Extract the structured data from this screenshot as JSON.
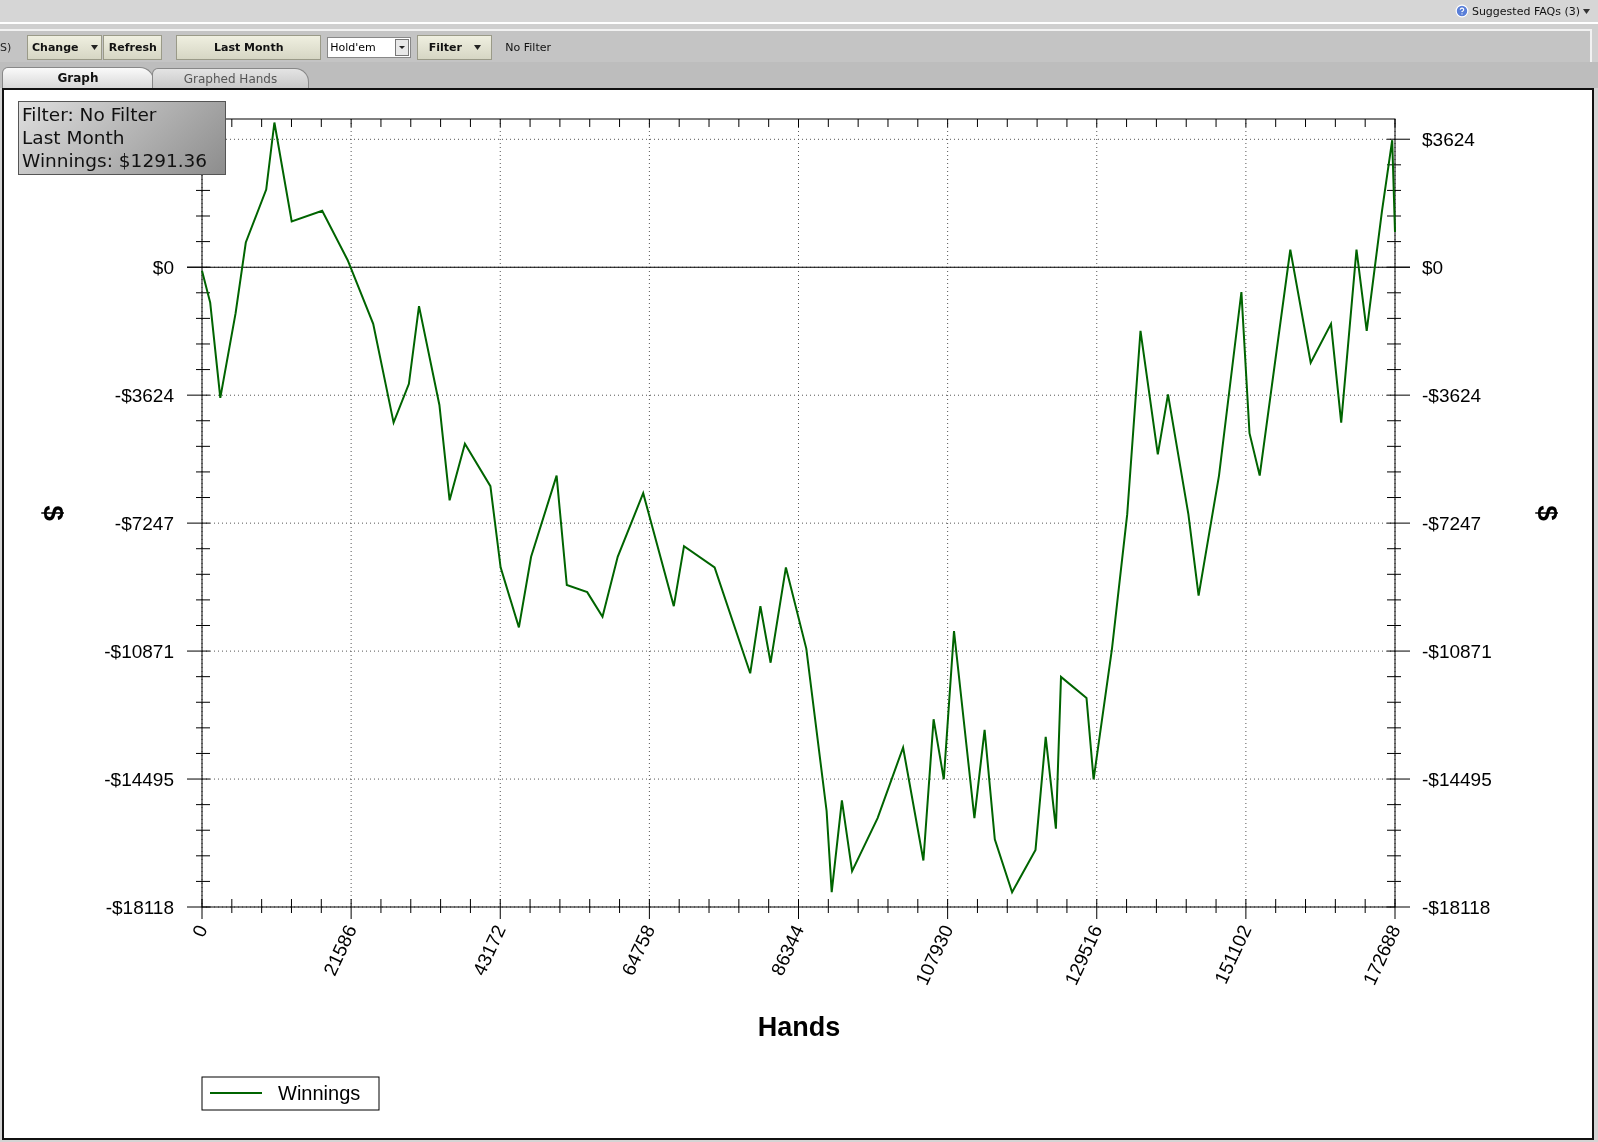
{
  "top_bar": {
    "faq_link": "Suggested FAQs (3)"
  },
  "toolbar": {
    "cut_label": "S)",
    "buttons": [
      {
        "label": "Change",
        "kind": "dropdown"
      },
      {
        "label": "Refresh",
        "kind": "button"
      },
      {
        "label": "Last Month",
        "kind": "wide"
      },
      {
        "label": "Hold'em",
        "kind": "select"
      },
      {
        "label": "Filter",
        "kind": "dropdown"
      }
    ],
    "filter_status": "No Filter"
  },
  "tabs": [
    {
      "label": "Graph",
      "selected": true
    },
    {
      "label": "Graphed Hands",
      "selected": false
    }
  ],
  "info_box": {
    "lines": [
      "Filter: No Filter",
      "Last Month",
      "Winnings: $1291.36"
    ]
  },
  "chart_data": {
    "type": "line",
    "xlabel": "Hands",
    "ylabel": "$",
    "x": [
      0,
      1180,
      2655,
      4868,
      6343,
      9293,
      10473,
      12980,
      17405,
      21093,
      24780,
      27730,
      29943,
      31418,
      34368,
      35843,
      38055,
      41743,
      43218,
      45873,
      47643,
      51330,
      52805,
      55755,
      57968,
      60180,
      63868,
      68293,
      69768,
      74193,
      79355,
      80830,
      82305,
      84518,
      87468,
      90418,
      91155,
      92630,
      94105,
      97793,
      101480,
      104430,
      105905,
      107380,
      108855,
      111805,
      113280,
      114755,
      117263,
      120655,
      122130,
      123605,
      124343,
      128030,
      129063,
      131718,
      133930,
      135848,
      138355,
      139830,
      142780,
      144255,
      147205,
      150450,
      151630,
      153105,
      157530,
      160480,
      163430,
      164905,
      167118,
      168593,
      170805,
      172280,
      172688
    ],
    "series": [
      {
        "name": "Winnings",
        "color": "#006400",
        "values": [
          -100,
          -1000,
          -3700,
          -1300,
          700,
          2200,
          4100,
          1300,
          1600,
          200,
          -1600,
          -4400,
          -3300,
          -1100,
          -3900,
          -6600,
          -5000,
          -6200,
          -8500,
          -10200,
          -8200,
          -5900,
          -9000,
          -9200,
          -9900,
          -8200,
          -6400,
          -9600,
          -7900,
          -8500,
          -11500,
          -9600,
          -11200,
          -8500,
          -10800,
          -15400,
          -17700,
          -15100,
          -17100,
          -15600,
          -13600,
          -16800,
          -12800,
          -14500,
          -10300,
          -15600,
          -13100,
          -16200,
          -17700,
          -16500,
          -13300,
          -15900,
          -11600,
          -12200,
          -14500,
          -10800,
          -7000,
          -1800,
          -5300,
          -3600,
          -7000,
          -9300,
          -5900,
          -700,
          -4700,
          -5900,
          500,
          -2700,
          -1600,
          -4400,
          500,
          -1800,
          1600,
          3600,
          1000
        ]
      }
    ],
    "grid": true,
    "xlim": [
      0,
      172688
    ],
    "ylim": [
      -18118,
      4199
    ],
    "xticks": [
      0,
      21586,
      43172,
      64758,
      86344,
      107930,
      129516,
      151102,
      172688
    ],
    "yticks": [
      {
        "value": 3624,
        "label": "$3624"
      },
      {
        "value": 0,
        "label": "$0"
      },
      {
        "value": -3624,
        "label": "-$3624"
      },
      {
        "value": -7247,
        "label": "-$7247"
      },
      {
        "value": -10871,
        "label": "-$10871"
      },
      {
        "value": -14495,
        "label": "-$14495"
      },
      {
        "value": -18118,
        "label": "-$18118"
      }
    ]
  }
}
